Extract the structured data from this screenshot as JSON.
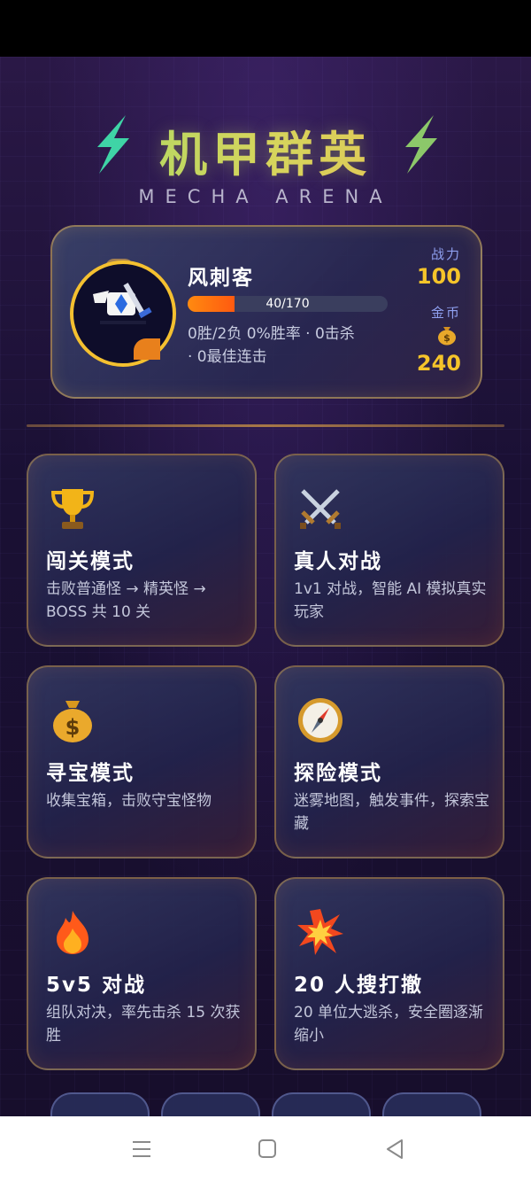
{
  "app": {
    "title": "机甲群英",
    "subtitle": "MECHA ARENA"
  },
  "profile": {
    "name": "风刺客",
    "xp_text": "40/170",
    "xp_progress": 0.235,
    "stats_line1": "0胜/2负 0%胜率 · 0击杀",
    "stats_line2": "· 0最佳连击",
    "power_label": "战力",
    "power_value": "100",
    "coins_label": "金币",
    "coins_value": "240"
  },
  "modes": [
    {
      "title": "闯关模式",
      "desc": "击败普通怪 → 精英怪 → BOSS 共 10 关",
      "icon": "trophy-icon"
    },
    {
      "title": "真人对战",
      "desc": "1v1 对战，智能 AI 模拟真实玩家",
      "icon": "crossed-swords-icon"
    },
    {
      "title": "寻宝模式",
      "desc": "收集宝箱，击败守宝怪物",
      "icon": "money-bag-icon"
    },
    {
      "title": "探险模式",
      "desc": "迷雾地图，触发事件，探索宝藏",
      "icon": "compass-icon"
    },
    {
      "title": "5v5 对战",
      "desc": "组队对决，率先击杀 15 次获胜",
      "icon": "fire-icon"
    },
    {
      "title": "20 人搜打撤",
      "desc": "20 单位大逃杀，安全圈逐渐缩小",
      "icon": "explosion-icon"
    }
  ],
  "colors": {
    "accent_gold": "#f5c42a",
    "xp_orange": "#ff7a10",
    "bolt_green": "#4fd8a8"
  }
}
